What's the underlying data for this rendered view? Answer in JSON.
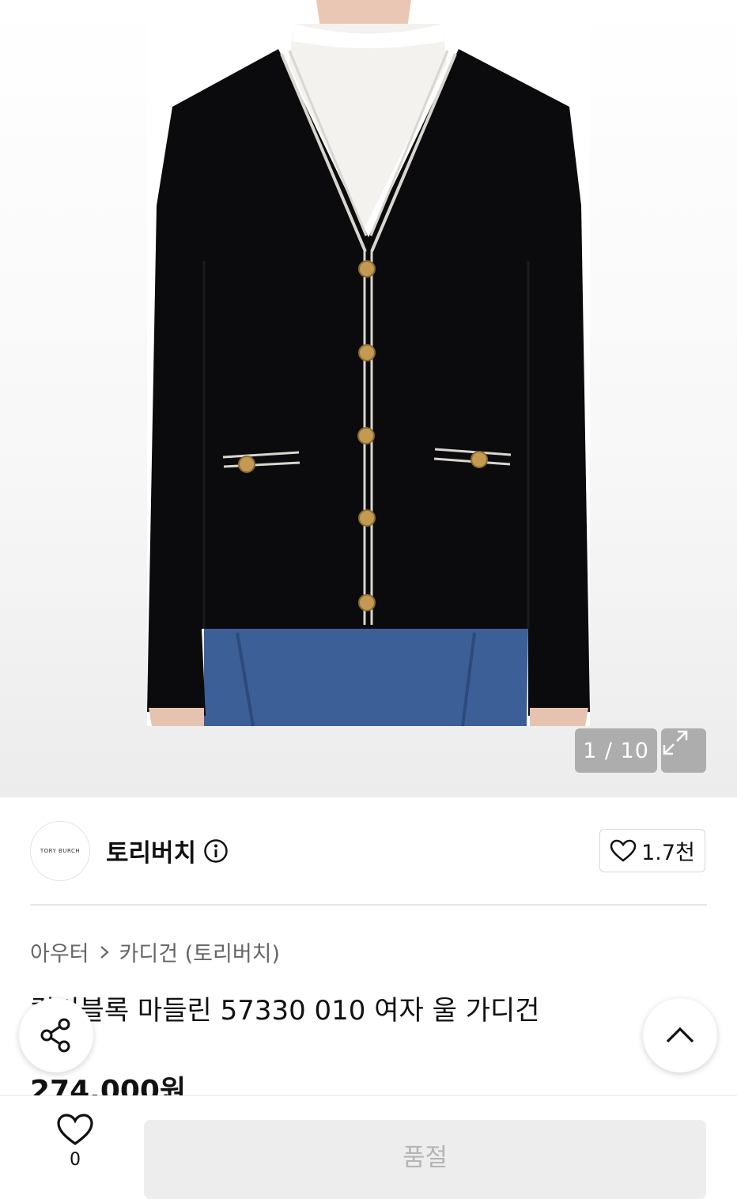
{
  "gallery": {
    "counter": "1 / 10"
  },
  "brand": {
    "logo_text": "TORY BURCH",
    "name": "토리버치",
    "likes": "1.7천"
  },
  "breadcrumb": {
    "category": "아우터",
    "subcategory": "카디건 (토리버치)"
  },
  "product": {
    "title": "컬러블록 마들린 57330 010 여자 울 가디건",
    "price": "274,000원"
  },
  "bottom_bar": {
    "wish_count": "0",
    "status_label": "품절"
  },
  "colors": {
    "accent_text": "#111111",
    "muted": "#666666",
    "soldout_bg": "#ededed"
  }
}
